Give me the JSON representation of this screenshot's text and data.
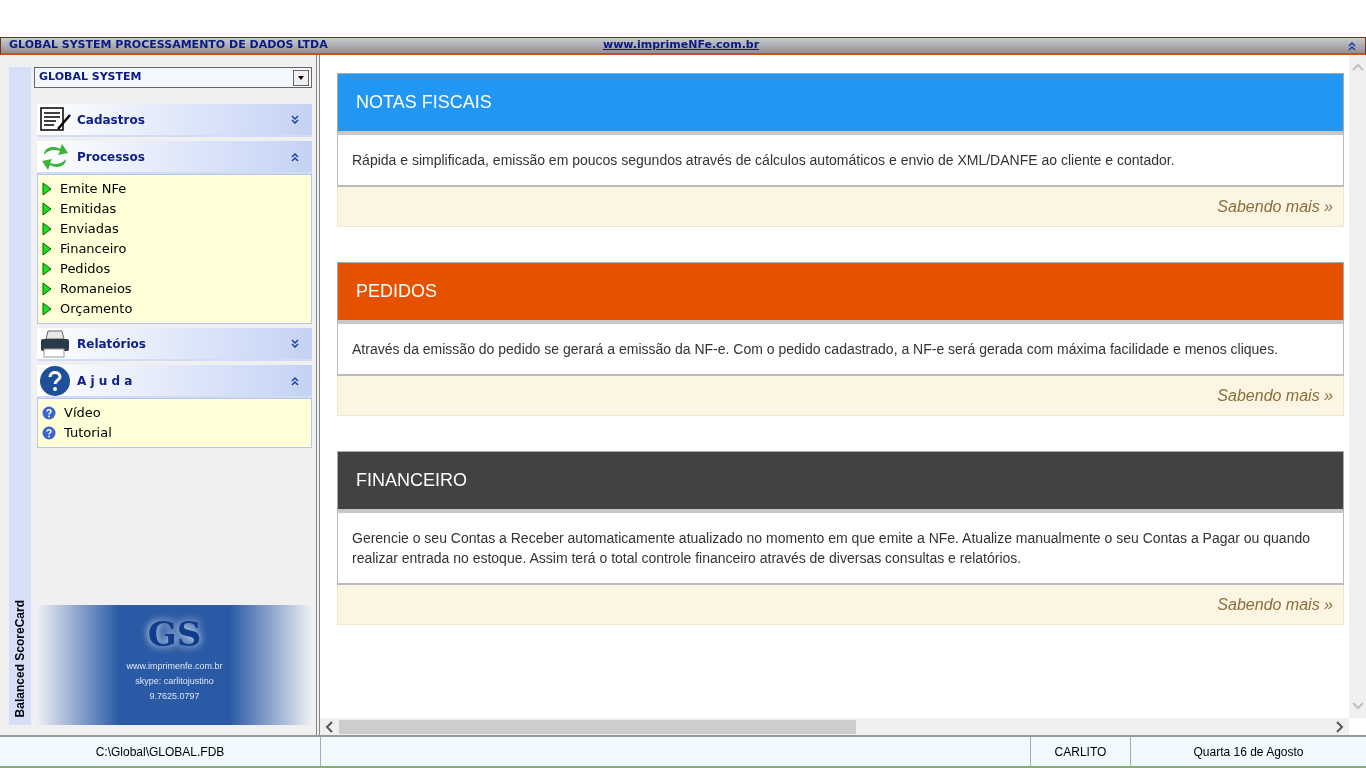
{
  "title_bar": {
    "company": "GLOBAL SYSTEM PROCESSAMENTO DE DADOS LTDA",
    "link": "www.imprimeNFe.com.br"
  },
  "sidebar": {
    "vertical_label": "Balanced ScoreCard",
    "selector": {
      "value": "GLOBAL SYSTEM"
    },
    "groups": [
      {
        "title": "Cadastros",
        "kind": "document",
        "expanded": false
      },
      {
        "title": "Processos",
        "kind": "refresh",
        "expanded": true,
        "items": [
          {
            "label": "Emite NFe",
            "kind": "arrow"
          },
          {
            "label": "Emitidas",
            "kind": "arrow"
          },
          {
            "label": "Enviadas",
            "kind": "arrow"
          },
          {
            "label": "Financeiro",
            "kind": "arrow"
          },
          {
            "label": "Pedidos",
            "kind": "arrow"
          },
          {
            "label": "Romaneios",
            "kind": "arrow"
          },
          {
            "label": "Orçamento",
            "kind": "arrow"
          }
        ]
      },
      {
        "title": "Relatórios",
        "kind": "printer",
        "expanded": false
      },
      {
        "title": "A j u d a",
        "kind": "help",
        "expanded": true,
        "items": [
          {
            "label": "Vídeo",
            "kind": "help"
          },
          {
            "label": "Tutorial",
            "kind": "help"
          }
        ]
      }
    ],
    "logo": {
      "letters": "GS",
      "lines": [
        "www.imprimenfe.com.br",
        "skype: carlitojustino",
        "9.7625.0797"
      ]
    }
  },
  "cards": [
    {
      "title": "NOTAS FISCAIS",
      "color": "#2196f3",
      "text": "Rápida e simplificada, emissão em poucos segundos através de cálculos automáticos e envio de XML/DANFE ao cliente e contador.",
      "link": "Sabendo mais »"
    },
    {
      "title": "PEDIDOS",
      "color": "#e65100",
      "text": "Através da emissão do pedido se gerará a emissão da NF-e. Com o pedido cadastrado, a NF-e será gerada com máxima facilidade e menos cliques.",
      "link": "Sabendo mais »"
    },
    {
      "title": "FINANCEIRO",
      "color": "#424242",
      "text": "Gerencie o seu Contas a Receber automaticamente atualizado no momento em que emite a NFe. Atualize manualmente o seu Contas a Pagar ou quando realizar entrada no estoque. Assim terá o total controle financeiro através de diversas consultas e relatórios.",
      "link": "Sabendo mais »"
    }
  ],
  "status_bar": {
    "database": "C:\\Global\\GLOBAL.FDB",
    "user": "CARLITO",
    "date": "Quarta 16 de Agosto"
  }
}
